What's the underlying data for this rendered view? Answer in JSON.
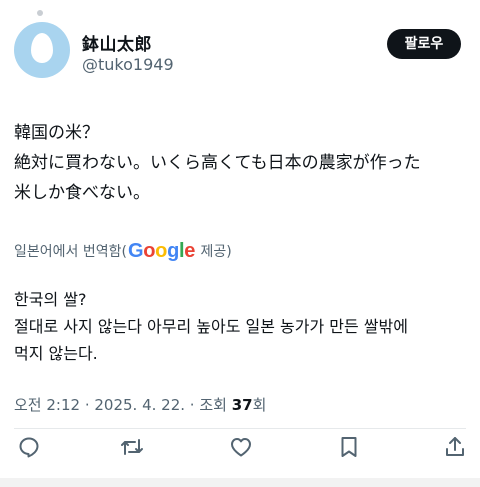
{
  "author": {
    "display_name": "鉢山太郎",
    "handle": "@tuko1949",
    "avatar_icon": "default-egg-avatar"
  },
  "follow_button": {
    "label": "팔로우"
  },
  "tweet": {
    "text": "韓国の米？\n絶対に買わない。いくら高くても日本の農家が作った\n米しか食べない。"
  },
  "translation": {
    "prefix": "일본어에서 번역함(",
    "provider_logo": "Google",
    "suffix": " 제공)",
    "text": "한국의 쌀?\n절대로 사지 않는다 아무리 높아도 일본 농가가 만든 쌀밖에\n먹지 않는다."
  },
  "meta": {
    "time": "오전 2:12",
    "separator": " · ",
    "date": "2025. 4. 22.",
    "views_label": "조회 ",
    "views_count": "37",
    "views_suffix": "회"
  },
  "actions": {
    "icons": [
      "reply-icon",
      "retweet-icon",
      "like-icon",
      "bookmark-icon",
      "share-icon"
    ]
  },
  "colors": {
    "text_primary": "#0f1419",
    "text_secondary": "#536471",
    "follow_button_bg": "#0f1419",
    "avatar_bg": "#a9d4ef"
  }
}
